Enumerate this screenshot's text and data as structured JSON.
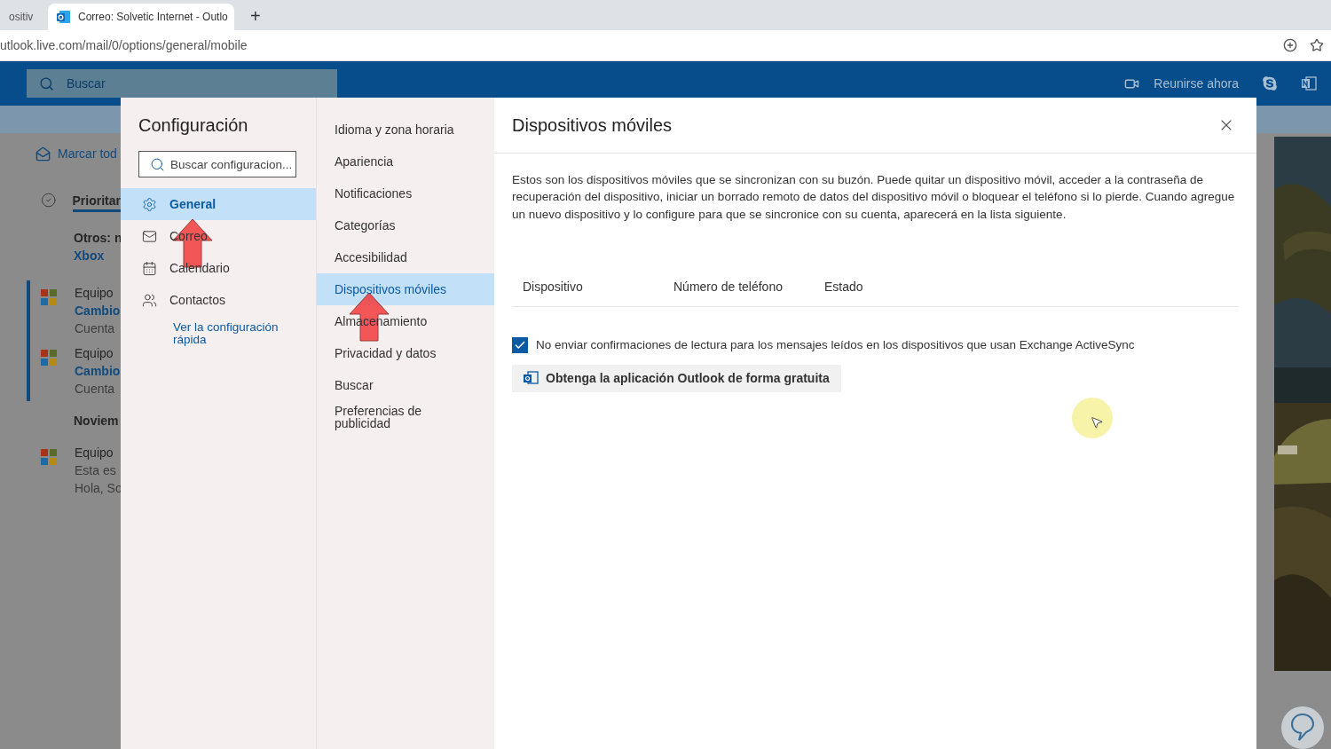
{
  "browser": {
    "tabs": [
      {
        "title": "ositiv",
        "selected": false
      },
      {
        "title": "Correo: Solvetic Internet - Outlo",
        "selected": true
      }
    ],
    "new_tab": "+",
    "url": "utlook.live.com/mail/0/options/general/mobile"
  },
  "header": {
    "search_placeholder": "Buscar",
    "meet_now": "Reunirse ahora"
  },
  "mail_list": {
    "mark_all": "Marcar tod",
    "focused_tab": "Prioritar",
    "items": [
      {
        "kind": "notice",
        "text": "Otros: n",
        "link": "Xbox"
      },
      {
        "kind": "message",
        "sender": "Equipo",
        "subject": "Cambio",
        "preview": "Cuenta",
        "unread": true
      },
      {
        "kind": "message",
        "sender": "Equipo",
        "subject": "Cambio",
        "preview": "Cuenta",
        "unread": true
      },
      {
        "kind": "date",
        "label": "Noviem"
      },
      {
        "kind": "message",
        "sender": "Equipo",
        "subject": "Esta es",
        "preview": "Hola, So",
        "unread": false
      }
    ]
  },
  "settings": {
    "title": "Configuración",
    "search_placeholder": "Buscar configuracion...",
    "categories": [
      {
        "label": "General",
        "selected": true
      },
      {
        "label": "Correo",
        "selected": false
      },
      {
        "label": "Calendario",
        "selected": false
      },
      {
        "label": "Contactos",
        "selected": false
      }
    ],
    "quick_link": "Ver la configuración rápida",
    "subcategories": [
      {
        "label": "Idioma y zona horaria",
        "selected": false
      },
      {
        "label": "Apariencia",
        "selected": false
      },
      {
        "label": "Notificaciones",
        "selected": false
      },
      {
        "label": "Categorías",
        "selected": false
      },
      {
        "label": "Accesibilidad",
        "selected": false
      },
      {
        "label": "Dispositivos móviles",
        "selected": true
      },
      {
        "label": "Almacenamiento",
        "selected": false
      },
      {
        "label": "Privacidad y datos",
        "selected": false
      },
      {
        "label": "Buscar",
        "selected": false
      },
      {
        "label": "Preferencias de publicidad",
        "selected": false
      }
    ],
    "content": {
      "title": "Dispositivos móviles",
      "description": "Estos son los dispositivos móviles que se sincronizan con su buzón. Puede quitar un dispositivo móvil, acceder a la contraseña de recuperación del dispositivo, iniciar un borrado remoto de datos del dispositivo móvil o bloquear el teléfono si lo pierde. Cuando agregue un nuevo dispositivo y lo configure para que se sincronice con su cuenta, aparecerá en la lista siguiente.",
      "columns": [
        "Dispositivo",
        "Número de teléfono",
        "Estado"
      ],
      "checkbox": {
        "label": "No enviar confirmaciones de lectura para los mensajes leídos en los dispositivos que usan Exchange ActiveSync",
        "checked": true
      },
      "button": "Obtenga la aplicación Outlook de forma gratuita"
    }
  }
}
